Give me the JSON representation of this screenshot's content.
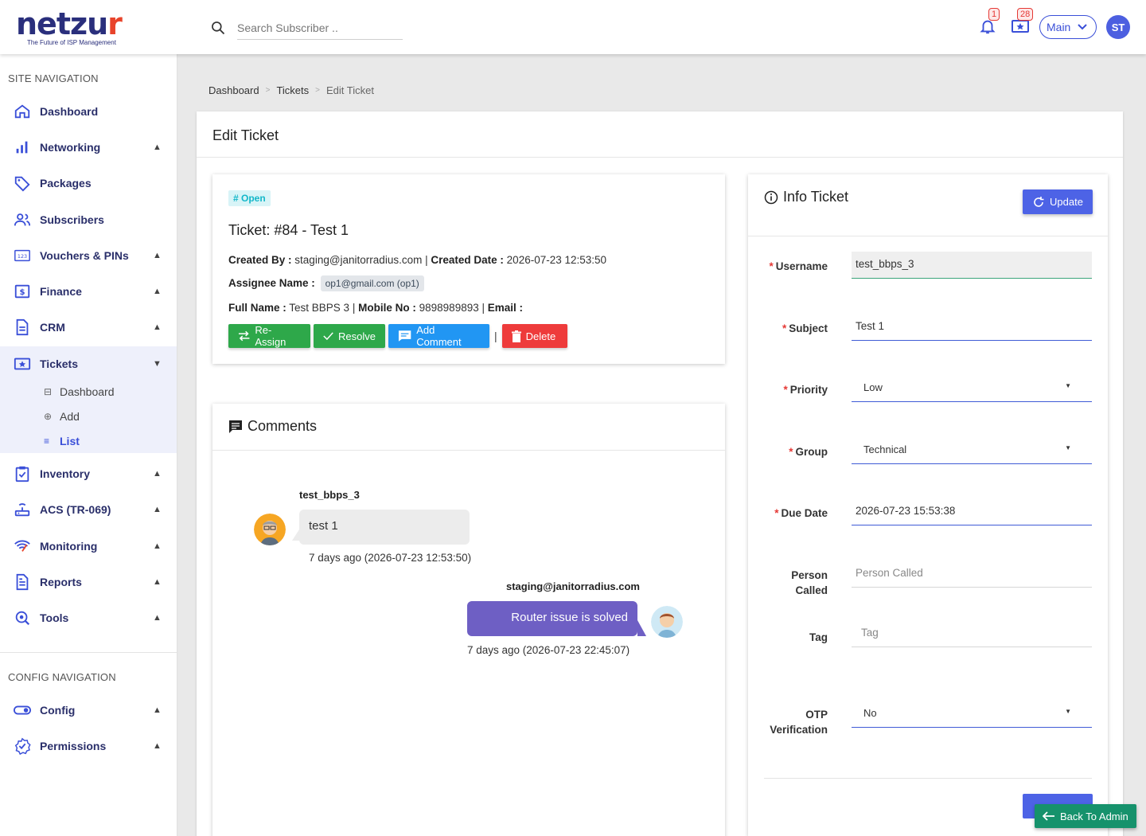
{
  "brand": {
    "name_main": "netzu",
    "name_accent": "r",
    "tagline": "The Future of ISP Management"
  },
  "search": {
    "placeholder": "Search Subscriber .."
  },
  "header": {
    "notifications_count": "1",
    "tickets_count": "28",
    "portal_label": "Main",
    "avatar_initials": "ST"
  },
  "sidebar": {
    "site_nav_title": "SITE NAVIGATION",
    "config_nav_title": "CONFIG NAVIGATION",
    "items": [
      {
        "label": "Dashboard",
        "caret": ""
      },
      {
        "label": "Networking",
        "caret": "▲"
      },
      {
        "label": "Packages",
        "caret": ""
      },
      {
        "label": "Subscribers",
        "caret": ""
      },
      {
        "label": "Vouchers & PINs",
        "caret": "▲"
      },
      {
        "label": "Finance",
        "caret": "▲"
      },
      {
        "label": "CRM",
        "caret": "▲"
      },
      {
        "label": "Tickets",
        "caret": "▼"
      },
      {
        "label": "Inventory",
        "caret": "▲"
      },
      {
        "label": "ACS (TR-069)",
        "caret": "▲"
      },
      {
        "label": "Monitoring",
        "caret": "▲"
      },
      {
        "label": "Reports",
        "caret": "▲"
      },
      {
        "label": "Tools",
        "caret": "▲"
      },
      {
        "label": "Config",
        "caret": "▲"
      },
      {
        "label": "Permissions",
        "caret": "▲"
      }
    ],
    "tickets_sub": [
      {
        "label": "Dashboard"
      },
      {
        "label": "Add"
      },
      {
        "label": "List"
      }
    ]
  },
  "breadcrumb": {
    "items": [
      "Dashboard",
      "Tickets",
      "Edit Ticket"
    ],
    "separator": ">"
  },
  "page": {
    "title": "Edit Ticket"
  },
  "ticket": {
    "status": "# Open",
    "title": "Ticket: #84 - Test 1",
    "created_by_label": "Created By :",
    "created_by": "staging@janitorradius.com",
    "created_date_label": "Created Date :",
    "created_date": "2026-07-23 12:53:50",
    "assignee_label": "Assignee Name :",
    "assignee": "op1@gmail.com (op1)",
    "full_name_label": "Full Name :",
    "full_name": "Test BBPS 3",
    "mobile_label": "Mobile No :",
    "mobile": "9898989893",
    "email_label": "Email :",
    "email": "",
    "sep": "|",
    "actions": {
      "reassign": "Re-Assign",
      "resolve": "Resolve",
      "add_comment": "Add Comment",
      "delete": "Delete"
    }
  },
  "comments": {
    "title": "Comments",
    "items": [
      {
        "author": "test_bbps_3",
        "text": "test 1",
        "time": "7 days ago (2026-07-23 12:53:50)"
      },
      {
        "author": "staging@janitorradius.com",
        "text": "Router issue is solved",
        "time": "7 days ago (2026-07-23 22:45:07)"
      }
    ]
  },
  "info": {
    "title": "Info Ticket",
    "update_label": "Update",
    "fields": {
      "username": {
        "label": "Username",
        "value": "test_bbps_3"
      },
      "subject": {
        "label": "Subject",
        "value": "Test 1"
      },
      "priority": {
        "label": "Priority",
        "value": "Low"
      },
      "group": {
        "label": "Group",
        "value": "Technical"
      },
      "due_date": {
        "label": "Due Date",
        "value": "2026-07-23 15:53:38"
      },
      "person_called": {
        "label_1": "Person",
        "label_2": "Called",
        "placeholder": "Person Called"
      },
      "tag": {
        "label": "Tag",
        "placeholder": "Tag"
      },
      "otp": {
        "label_1": "OTP",
        "label_2": "Verification",
        "value": "No"
      }
    }
  },
  "footer": {
    "back_label": "Back To Admin"
  },
  "colors": {
    "primary": "#4d63e6",
    "nav_text": "#2a2f6a",
    "success": "#2ea84a",
    "danger": "#ee3b3b",
    "info": "#2196f3",
    "bubble": "#6e5fc4"
  }
}
